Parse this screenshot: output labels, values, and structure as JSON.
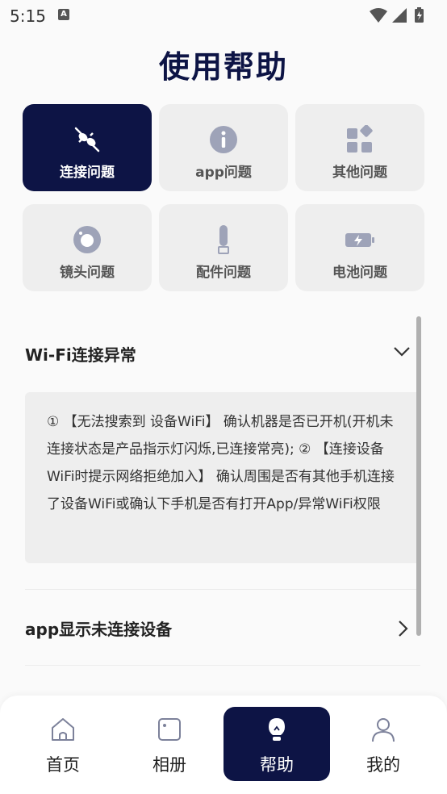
{
  "status_bar": {
    "time": "5:15",
    "notification_icon": "A"
  },
  "page": {
    "title": "使用帮助"
  },
  "categories": [
    {
      "label": "连接问题",
      "icon": "plug-icon",
      "active": true
    },
    {
      "label": "app问题",
      "icon": "info-icon",
      "active": false
    },
    {
      "label": "其他问题",
      "icon": "grid-icon",
      "active": false
    },
    {
      "label": "镜头问题",
      "icon": "lens-icon",
      "active": false
    },
    {
      "label": "配件问题",
      "icon": "accessory-icon",
      "active": false
    },
    {
      "label": "电池问题",
      "icon": "battery-icon",
      "active": false
    }
  ],
  "faqs": [
    {
      "title": "Wi-Fi连接异常",
      "expanded": true,
      "answer": "① 【无法搜索到 设备WiFi】 确认机器是否已开机(开机未连接状态是产品指示灯闪烁,已连接常亮); ② 【连接设备WiFi时提示网络拒绝加入】 确认周围是否有其他手机连接了设备WiFi或确认下手机是否有打开App/异常WiFi权限"
    },
    {
      "title": "app显示未连接设备",
      "expanded": false
    }
  ],
  "bottom_nav": [
    {
      "label": "首页",
      "icon": "home-icon",
      "active": false
    },
    {
      "label": "相册",
      "icon": "album-icon",
      "active": false
    },
    {
      "label": "帮助",
      "icon": "help-bulb-icon",
      "active": true
    },
    {
      "label": "我的",
      "icon": "profile-icon",
      "active": false
    }
  ],
  "colors": {
    "accent": "#0d1445",
    "card_bg": "#eeeeee",
    "icon_gray": "#9ea3b8"
  }
}
